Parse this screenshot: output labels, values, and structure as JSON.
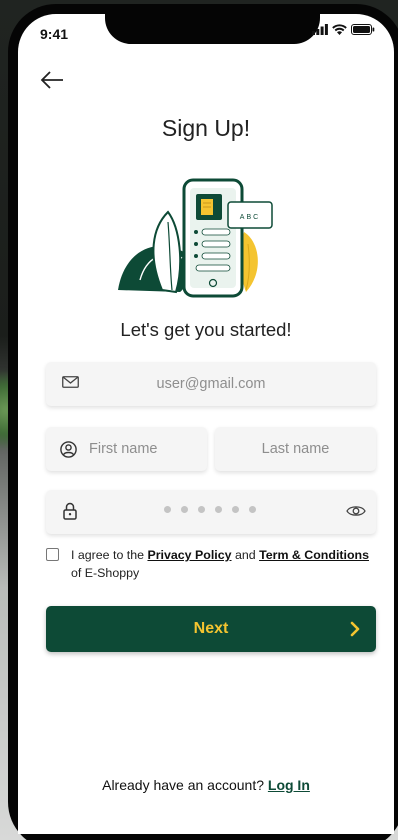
{
  "status_bar": {
    "time": "9:41"
  },
  "header": {
    "title": "Sign Up!"
  },
  "illustration": {
    "card_text": "ABC"
  },
  "subtitle": "Let's get you started!",
  "form": {
    "email": {
      "placeholder": "user@gmail.com",
      "value": ""
    },
    "first_name": {
      "placeholder": "First name",
      "value": ""
    },
    "last_name": {
      "placeholder": "Last name",
      "value": ""
    },
    "password": {
      "masked_length": 6
    }
  },
  "agreement": {
    "checked": false,
    "prefix": "I agree to the ",
    "privacy_link": "Privacy Policy",
    "middle": " and ",
    "terms_link": "Term & Conditions",
    "suffix": " of E-Shoppy"
  },
  "next_button": {
    "label": "Next"
  },
  "footer": {
    "prompt": "Already have an account? ",
    "login_link": "Log In"
  },
  "icons": {
    "back": "arrow-left-icon",
    "email": "envelope-icon",
    "user": "user-circle-icon",
    "lock": "lock-icon",
    "eye": "eye-icon",
    "chevron": "chevron-right-icon"
  },
  "colors": {
    "brand_green": "#0d4a36",
    "accent_yellow": "#f4c430",
    "field_bg": "#f5f5f5",
    "placeholder": "#8e8e8e"
  }
}
